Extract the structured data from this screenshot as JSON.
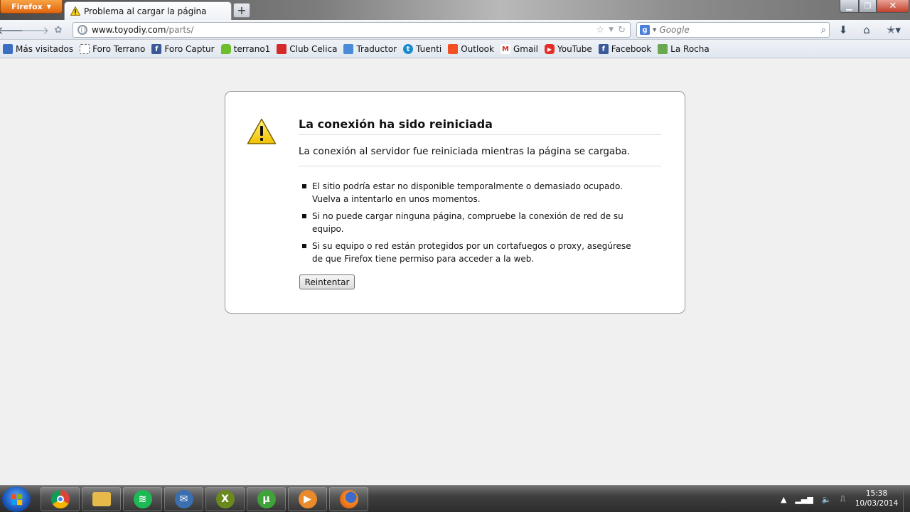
{
  "browser": {
    "menu_label": "Firefox",
    "tab_title": "Problema al cargar la página",
    "new_tab": "+",
    "url_host": "www.toyodiy.com",
    "url_path": "/parts/",
    "search_placeholder": "Google",
    "search_engine_glyph": "g"
  },
  "bookmarks": [
    {
      "label": "Más visitados",
      "icon": "most-visited-icon",
      "color": "#3a6fc4"
    },
    {
      "label": "Foro Terrano",
      "icon": "blank-page-icon",
      "color": "#ffffff"
    },
    {
      "label": "Foro Captur",
      "icon": "facebook-icon",
      "color": "#3b5998"
    },
    {
      "label": "terrano1",
      "icon": "chat-bubble-icon",
      "color": "#6cbf2b"
    },
    {
      "label": "Club Celica",
      "icon": "celica-logo-icon",
      "color": "#d42a2a"
    },
    {
      "label": "Traductor",
      "icon": "translate-icon",
      "color": "#4a8ad8"
    },
    {
      "label": "Tuenti",
      "icon": "tuenti-icon",
      "color": "#1b8ad0"
    },
    {
      "label": "Outlook",
      "icon": "windows-logo-icon",
      "color": "#f25022"
    },
    {
      "label": "Gmail",
      "icon": "gmail-icon",
      "color": "#d93025"
    },
    {
      "label": "YouTube",
      "icon": "youtube-icon",
      "color": "#e52d27"
    },
    {
      "label": "Facebook",
      "icon": "facebook-icon",
      "color": "#3b5998"
    },
    {
      "label": "La Rocha",
      "icon": "la-rocha-icon",
      "color": "#6aa84f"
    }
  ],
  "error": {
    "title": "La conexión ha sido reiniciada",
    "description": "La conexión al servidor fue reiniciada mientras la página se cargaba.",
    "bullets": [
      "El sitio podría estar no disponible temporalmente o demasiado ocupado. Vuelva a intentarlo en unos momentos.",
      "Si no puede cargar ninguna página, compruebe la conexión de red de su equipo.",
      "Si su equipo o red están protegidos por un cortafuegos o proxy, asegúrese de que Firefox tiene permiso para acceder a la web."
    ],
    "retry_label": "Reintentar"
  },
  "taskbar": {
    "apps": [
      {
        "name": "chrome",
        "icon": "chrome-icon",
        "glyph": "",
        "color": "#e0a400"
      },
      {
        "name": "explorer",
        "icon": "folder-icon",
        "glyph": "",
        "color": "#e6b94a"
      },
      {
        "name": "spotify",
        "icon": "spotify-icon",
        "glyph": "≋",
        "color": "#1db954"
      },
      {
        "name": "thunderbird",
        "icon": "thunderbird-icon",
        "glyph": "✉",
        "color": "#3a6fb0"
      },
      {
        "name": "app-x",
        "icon": "green-x-icon",
        "glyph": "X",
        "color": "#6a8a1e"
      },
      {
        "name": "utorrent",
        "icon": "utorrent-icon",
        "glyph": "µ",
        "color": "#3fa33a"
      },
      {
        "name": "media-player",
        "icon": "media-player-icon",
        "glyph": "▶",
        "color": "#e98a2b"
      },
      {
        "name": "firefox",
        "icon": "firefox-icon",
        "glyph": "",
        "color": "#e66000"
      }
    ],
    "time": "15:38",
    "date": "10/03/2014"
  }
}
